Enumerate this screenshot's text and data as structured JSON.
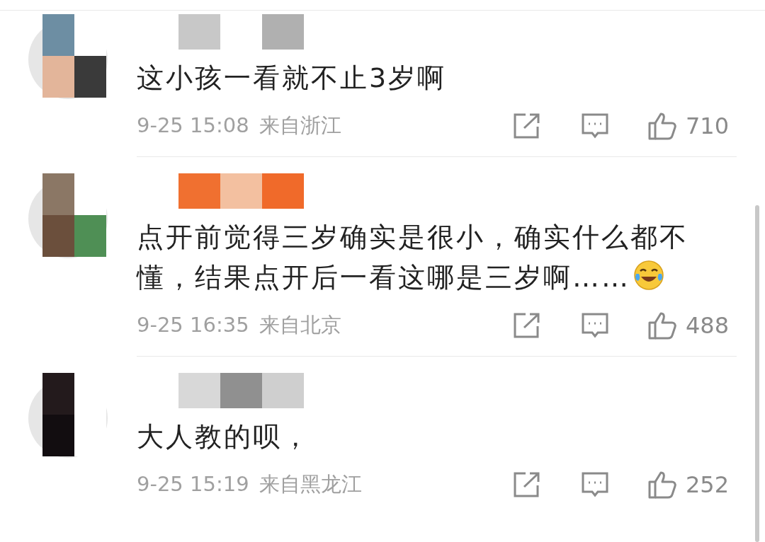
{
  "comments": [
    {
      "text": "这小孩一看就不止3岁啊",
      "emoji": false,
      "time": "9-25 15:08",
      "location": "来自浙江",
      "likes": "710"
    },
    {
      "text": "点开前觉得三岁确实是很小，确实什么都不懂，结果点开后一看这哪是三岁啊……",
      "emoji": true,
      "time": "9-25 16:35",
      "location": "来自北京",
      "likes": "488"
    },
    {
      "text": "大人教的呗，",
      "emoji": false,
      "time": "9-25 15:19",
      "location": "来自黑龙江",
      "likes": "252"
    }
  ]
}
